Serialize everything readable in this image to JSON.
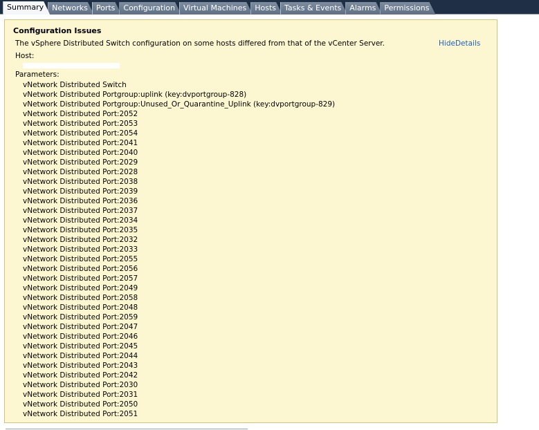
{
  "tabs": [
    {
      "label": "Summary",
      "active": true
    },
    {
      "label": "Networks",
      "active": false
    },
    {
      "label": "Ports",
      "active": false
    },
    {
      "label": "Configuration",
      "active": false
    },
    {
      "label": "Virtual Machines",
      "active": false
    },
    {
      "label": "Hosts",
      "active": false
    },
    {
      "label": "Tasks & Events",
      "active": false
    },
    {
      "label": "Alarms",
      "active": false
    },
    {
      "label": "Permissions",
      "active": false
    }
  ],
  "issues": {
    "heading": "Configuration Issues",
    "message": "The vSphere Distributed Switch configuration on some hosts differed from that of the vCenter Server.",
    "hide_details": "HideDetails",
    "host_label": "Host:",
    "host_value": "",
    "parameters_label": "Parameters:",
    "parameters": [
      "vNetwork Distributed Switch",
      "vNetwork Distributed Portgroup:uplink (key:dvportgroup-828)",
      "vNetwork Distributed Portgroup:Unused_Or_Quarantine_Uplink (key:dvportgroup-829)",
      "vNetwork Distributed Port:2052",
      "vNetwork Distributed Port:2053",
      "vNetwork Distributed Port:2054",
      "vNetwork Distributed Port:2041",
      "vNetwork Distributed Port:2040",
      "vNetwork Distributed Port:2029",
      "vNetwork Distributed Port:2028",
      "vNetwork Distributed Port:2038",
      "vNetwork Distributed Port:2039",
      "vNetwork Distributed Port:2036",
      "vNetwork Distributed Port:2037",
      "vNetwork Distributed Port:2034",
      "vNetwork Distributed Port:2035",
      "vNetwork Distributed Port:2032",
      "vNetwork Distributed Port:2033",
      "vNetwork Distributed Port:2055",
      "vNetwork Distributed Port:2056",
      "vNetwork Distributed Port:2057",
      "vNetwork Distributed Port:2049",
      "vNetwork Distributed Port:2058",
      "vNetwork Distributed Port:2048",
      "vNetwork Distributed Port:2059",
      "vNetwork Distributed Port:2047",
      "vNetwork Distributed Port:2046",
      "vNetwork Distributed Port:2045",
      "vNetwork Distributed Port:2044",
      "vNetwork Distributed Port:2043",
      "vNetwork Distributed Port:2042",
      "vNetwork Distributed Port:2030",
      "vNetwork Distributed Port:2031",
      "vNetwork Distributed Port:2050",
      "vNetwork Distributed Port:2051"
    ]
  },
  "colors": {
    "tabbar_bg": "#1f2f45",
    "panel_bg": "#fcf7d0",
    "panel_border": "#cfc47a",
    "link": "#1f5fbf"
  }
}
